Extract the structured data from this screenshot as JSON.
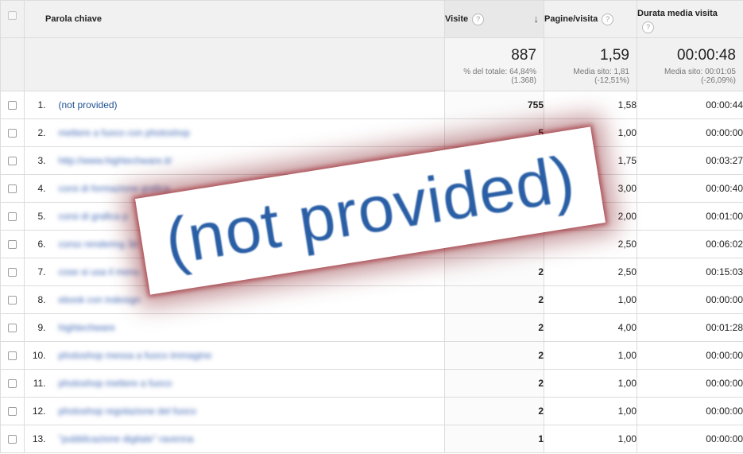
{
  "header": {
    "keyword": "Parola chiave",
    "visits": "Visite",
    "pages_per_visit": "Pagine/visita",
    "avg_duration": "Durata media visita",
    "help_glyph": "?",
    "sort_glyph": "↓"
  },
  "summary": {
    "visits_total": "887",
    "visits_sub": "% del totale: 64,84% (1.368)",
    "pages_total": "1,59",
    "pages_sub": "Media sito: 1,81 (-12,51%)",
    "duration_total": "00:00:48",
    "duration_sub": "Media sito: 00:01:05 (-26,09%)"
  },
  "rows": [
    {
      "index": "1.",
      "keyword": "(not provided)",
      "visits": "755",
      "pages": "1,58",
      "duration": "00:00:44",
      "blurred": false
    },
    {
      "index": "2.",
      "keyword": "mettere a fuoco con photoshop",
      "visits": "5",
      "pages": "1,00",
      "duration": "00:00:00",
      "blurred": true
    },
    {
      "index": "3.",
      "keyword": "http://www.hightechware.it/",
      "visits": "",
      "pages": "1,75",
      "duration": "00:03:27",
      "blurred": true
    },
    {
      "index": "4.",
      "keyword": "corsi di formazione grafica",
      "visits": "",
      "pages": "3,00",
      "duration": "00:00:40",
      "blurred": true
    },
    {
      "index": "5.",
      "keyword": "corsi di grafica p",
      "visits": "",
      "pages": "2,00",
      "duration": "00:01:00",
      "blurred": true
    },
    {
      "index": "6.",
      "keyword": "corso rendering 3d",
      "visits": "",
      "pages": "2,50",
      "duration": "00:06:02",
      "blurred": true
    },
    {
      "index": "7.",
      "keyword": "cose si usa il menu",
      "visits": "2",
      "pages": "2,50",
      "duration": "00:15:03",
      "blurred": true
    },
    {
      "index": "8.",
      "keyword": "ebook con indesign",
      "visits": "2",
      "pages": "1,00",
      "duration": "00:00:00",
      "blurred": true
    },
    {
      "index": "9.",
      "keyword": "hightechware",
      "visits": "2",
      "pages": "4,00",
      "duration": "00:01:28",
      "blurred": true
    },
    {
      "index": "10.",
      "keyword": "photoshop messa a fuoco immagine",
      "visits": "2",
      "pages": "1,00",
      "duration": "00:00:00",
      "blurred": true
    },
    {
      "index": "11.",
      "keyword": "photoshop mettere a fuoco",
      "visits": "2",
      "pages": "1,00",
      "duration": "00:00:00",
      "blurred": true
    },
    {
      "index": "12.",
      "keyword": "photoshop regolazione del fuoco",
      "visits": "2",
      "pages": "1,00",
      "duration": "00:00:00",
      "blurred": true
    },
    {
      "index": "13.",
      "keyword": "\"pubblicazione digitale\" ravenna",
      "visits": "1",
      "pages": "1,00",
      "duration": "00:00:00",
      "blurred": true
    }
  ],
  "overlay": {
    "text": "(not provided)"
  },
  "colors": {
    "link": "#1e4f94",
    "overlay_text": "#2a5fa6",
    "overlay_glow": "#8c1420",
    "header_bg": "#f1f1f1"
  }
}
